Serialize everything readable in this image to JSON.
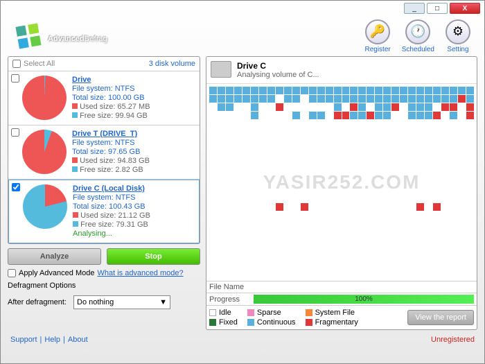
{
  "app": {
    "title_a": "Advanced",
    "title_b": "Defrag"
  },
  "titlebar": {
    "min": "_",
    "max": "□",
    "close": "X"
  },
  "toolbar": {
    "register": "Register",
    "scheduled": "Scheduled",
    "setting": "Setting"
  },
  "sidebar": {
    "select_all": "Select All",
    "volume_count": "3 disk volume",
    "drives": [
      {
        "name": "Drive",
        "fs": "File system: NTFS",
        "total": "Total size: 100.00 GB",
        "used": "Used size: 65.27 MB",
        "free": "Free size: 99.94 GB",
        "status": ""
      },
      {
        "name": "Drive T (DRIVE_T)",
        "fs": "File system: NTFS",
        "total": "Total size: 97.65 GB",
        "used": "Used size: 94.83 GB",
        "free": "Free size: 2.82 GB",
        "status": ""
      },
      {
        "name": "Drive C (Local Disk)",
        "fs": "File system: NTFS",
        "total": "Total size: 100.43 GB",
        "used": "Used size: 21.12 GB",
        "free": "Free size: 79.31 GB",
        "status": "Analysing..."
      }
    ],
    "analyze": "Analyze",
    "stop": "Stop",
    "apply_adv": "Apply Advanced Mode",
    "what_adv": "What is advanced mode?",
    "defrag_opts": "Defragment Options",
    "after_label": "After defragment:",
    "after_value": "Do nothing"
  },
  "main": {
    "drive_title": "Drive C",
    "drive_sub": "Analysing volume of C...",
    "watermark": "YASIR252.COM",
    "file_name_label": "File Name",
    "progress_label": "Progress",
    "progress_value": "100%",
    "legend": {
      "idle": "Idle",
      "fixed": "Fixed",
      "sparse": "Sparse",
      "continuous": "Continuous",
      "system": "System File",
      "fragmentary": "Fragmentary"
    },
    "view_report": "View the report"
  },
  "footer": {
    "support": "Support",
    "help": "Help",
    "about": "About",
    "unregistered": "Unregistered"
  },
  "chart_data": [
    {
      "type": "pie",
      "title": "Drive",
      "series": [
        {
          "name": "Used",
          "values": [
            65.27
          ]
        },
        {
          "name": "Free",
          "values": [
            99940
          ]
        }
      ],
      "unit": "MB"
    },
    {
      "type": "pie",
      "title": "Drive T",
      "series": [
        {
          "name": "Used",
          "values": [
            94.83
          ]
        },
        {
          "name": "Free",
          "values": [
            2.82
          ]
        }
      ],
      "unit": "GB"
    },
    {
      "type": "pie",
      "title": "Drive C",
      "series": [
        {
          "name": "Used",
          "values": [
            21.12
          ]
        },
        {
          "name": "Free",
          "values": [
            79.31
          ]
        }
      ],
      "unit": "GB"
    }
  ]
}
